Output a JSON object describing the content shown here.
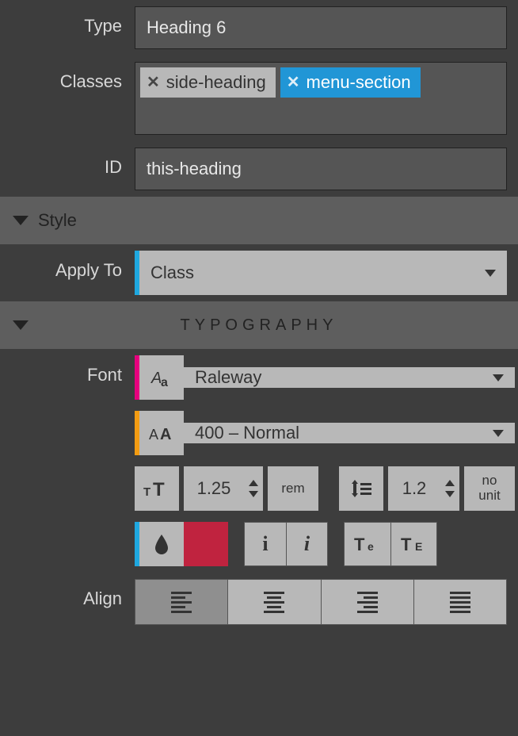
{
  "element": {
    "type_label": "Type",
    "type_value": "Heading 6",
    "classes_label": "Classes",
    "class_tags": [
      "side-heading",
      "menu-section"
    ],
    "selected_class_index": 1,
    "id_label": "ID",
    "id_value": "this-heading"
  },
  "style_section": {
    "title": "Style",
    "apply_to_label": "Apply To",
    "apply_to_value": "Class",
    "apply_to_accent": "#1fa8e0"
  },
  "typography": {
    "title": "TYPOGRAPHY",
    "font_label": "Font",
    "font_family": "Raleway",
    "font_family_accent": "#e6007e",
    "font_weight": "400 – Normal",
    "font_weight_accent": "#f39c12",
    "font_size": "1.25",
    "font_size_unit": "rem",
    "line_height": "1.2",
    "line_height_unit_line1": "no",
    "line_height_unit_line2": "unit",
    "color_accent": "#1fa8e0",
    "color_swatch": "#c0233f",
    "italic_active": "normal",
    "text_transform": "none",
    "align_label": "Align",
    "align_options": [
      "left",
      "center",
      "right",
      "justify"
    ],
    "align_active": "left"
  }
}
